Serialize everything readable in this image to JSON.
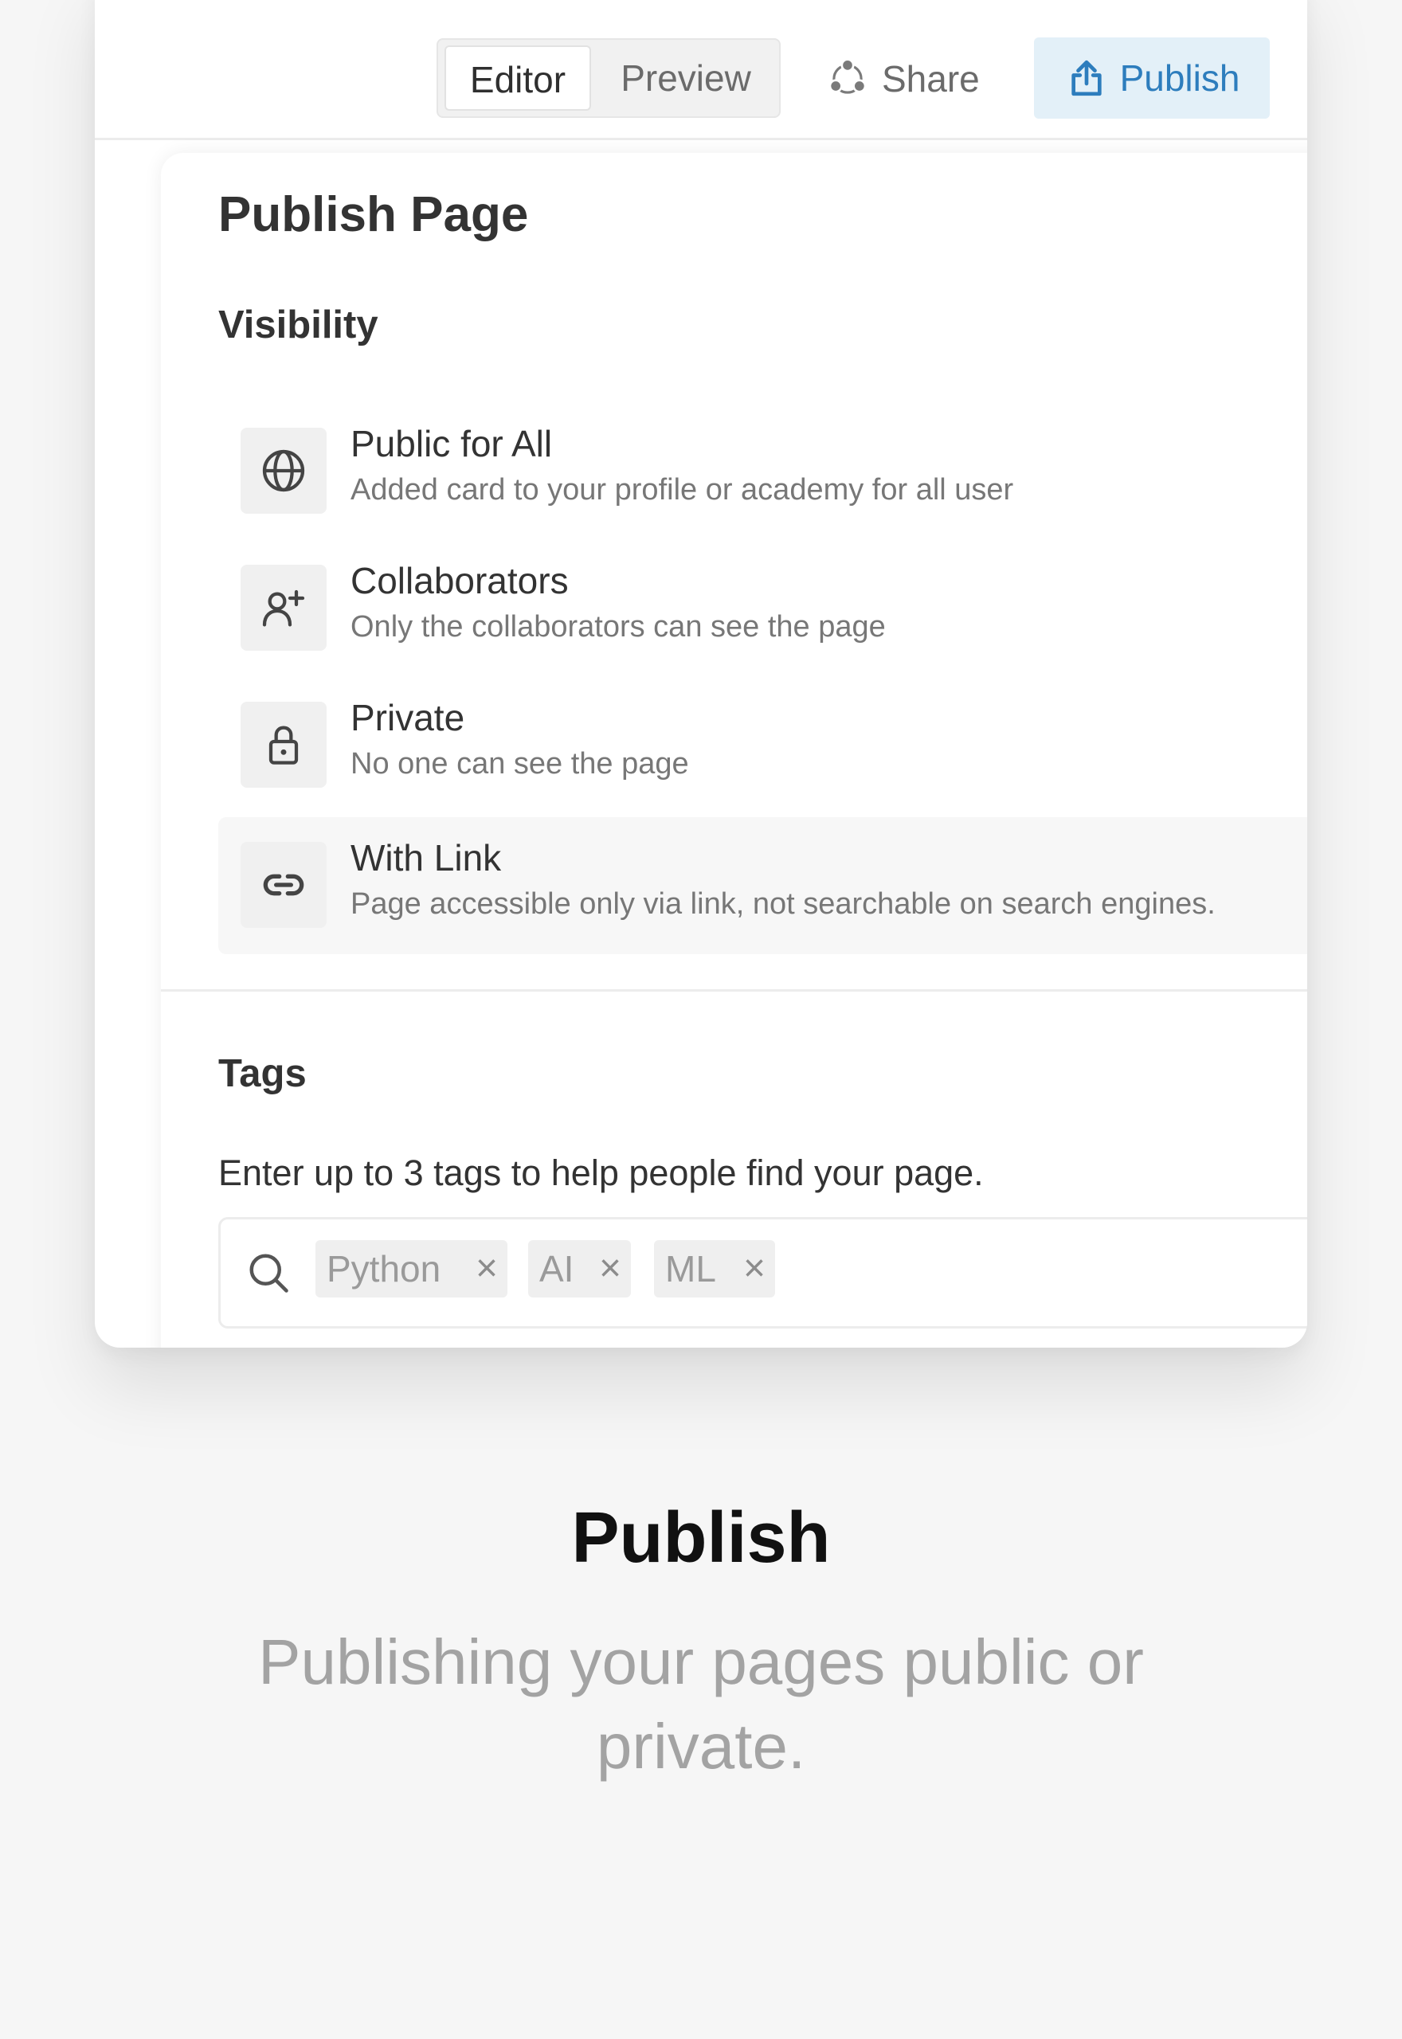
{
  "header": {
    "tabs": [
      {
        "label": "Editor",
        "active": true
      },
      {
        "label": "Preview",
        "active": false
      }
    ],
    "share_label": "Share",
    "publish_label": "Publish",
    "share_icon": "share-icon",
    "publish_icon": "upload-icon"
  },
  "dialog": {
    "title": "Publish Page",
    "visibility_heading": "Visibility",
    "options": [
      {
        "icon": "globe-icon",
        "title": "Public for All",
        "description": "Added card to your profile or academy for all user",
        "selected": false
      },
      {
        "icon": "person-add-icon",
        "title": "Collaborators",
        "description": "Only the collaborators can see the page",
        "selected": false
      },
      {
        "icon": "lock-icon",
        "title": "Private",
        "description": "No one can see the page",
        "selected": false
      },
      {
        "icon": "link-icon",
        "title": "With Link",
        "description": "Page accessible only via link, not searchable on search engines.",
        "selected": true
      }
    ],
    "tags_heading": "Tags",
    "tags_hint": "Enter up to 3 tags to help people find your page.",
    "tags": [
      "Python",
      "AI",
      "ML"
    ],
    "remove_symbol": "×"
  },
  "feature": {
    "title": "Publish",
    "subtitle": "Publishing your pages public or private."
  },
  "colors": {
    "accent": "#2d7dbd",
    "accent_bg": "#e3f0f8",
    "page_bg": "#f6f6f6",
    "selected_bg": "#f7f7f7"
  }
}
